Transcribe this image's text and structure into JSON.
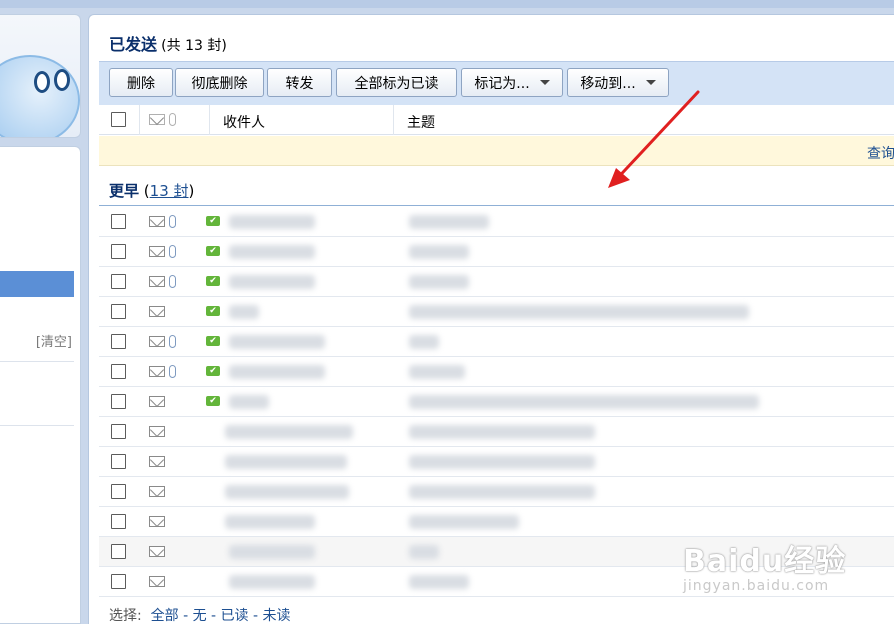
{
  "sidebar": {
    "clear_label": "[清空]"
  },
  "header": {
    "title": "已发送",
    "count": "(共 13 封)"
  },
  "toolbar": {
    "delete": "删除",
    "delete_perm": "彻底删除",
    "forward": "转发",
    "mark_all_read": "全部标为已读",
    "mark_as": "标记为...",
    "move_to": "移动到..."
  },
  "columns": {
    "recipient": "收件人",
    "subject": "主题"
  },
  "notice": {
    "text": "查询"
  },
  "group": {
    "name": "更早",
    "count_link": "13 封"
  },
  "footer": {
    "select_label": "选择:",
    "all": "全部",
    "none": "无",
    "read": "已读",
    "unread": "未读",
    "sep": "-"
  },
  "watermark": {
    "brand": "Baidu经验",
    "url": "jingyan.baidu.com"
  },
  "colors": {
    "accent": "#0a2f6b",
    "link": "#1d4f91",
    "toolbar_bg": "#d4e3f6",
    "arrow": "#e02020"
  }
}
